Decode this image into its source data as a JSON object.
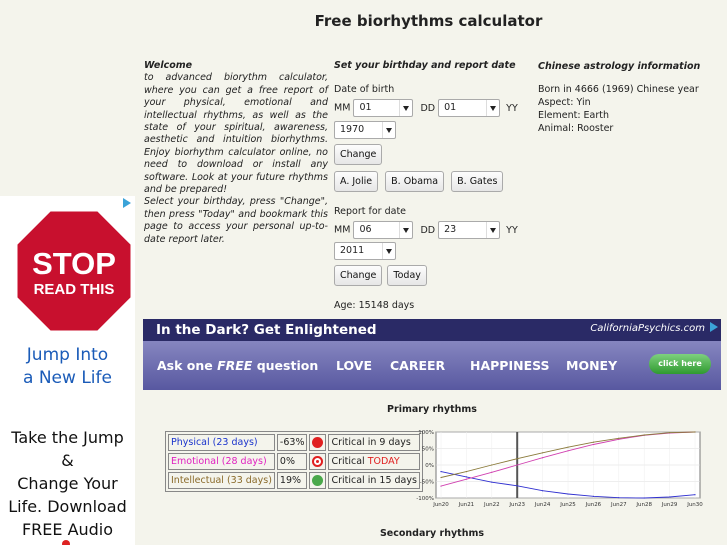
{
  "page": {
    "title": "Free biorhythms calculator"
  },
  "welcome": {
    "heading": "Welcome",
    "p1": "to advanced biorythm calculator, where you can get a free report of your physical, emotional and intellectual rhythms, as well as the state of your spiritual, awareness, aesthetic and intuition biorhythms. Enjoy biorhythm calculator online, no need to download or install any software. Look at your future rhythms and be prepared!",
    "p2": "Select your birthday, press \"Change\", then press \"Today\" and bookmark this page to access your personal up-to-date report later."
  },
  "birth_form": {
    "heading": "Set your birthday and report date",
    "label": "Date of birth",
    "mm_label": "MM",
    "mm_value": "01",
    "dd_label": "DD",
    "dd_value": "01",
    "yy_label": "YY",
    "yy_value": "1970",
    "change_label": "Change",
    "presets": [
      "A. Jolie",
      "B. Obama",
      "B. Gates"
    ]
  },
  "report_form": {
    "label": "Report for date",
    "mm_label": "MM",
    "mm_value": "06",
    "dd_label": "DD",
    "dd_value": "23",
    "yy_label": "YY",
    "yy_value": "2011",
    "change_label": "Change",
    "today_label": "Today"
  },
  "age": "Age: 15148 days",
  "chinese": {
    "heading": "Chinese astrology information",
    "born": "Born in 4666 (1969) Chinese year",
    "aspect": "Aspect: Yin",
    "element": "Element: Earth",
    "animal": "Animal: Rooster"
  },
  "ad_left": {
    "stop_line1": "STOP",
    "stop_line2": "READ THIS",
    "jump1": "Jump Into",
    "jump2": "a New Life",
    "take1": "Take the Jump",
    "take2": "&",
    "take3": "Change Your",
    "take4": "Life.  Download",
    "take5": "FREE Audio"
  },
  "banner": {
    "headline": "In the Dark? Get Enlightened",
    "brand": "CaliforniaPsychics.com",
    "ask_prefix": "Ask one ",
    "ask_free": "FREE",
    "ask_suffix": " question",
    "cats": [
      "LOVE",
      "CAREER",
      "HAPPINESS",
      "MONEY"
    ],
    "click": "click here"
  },
  "primary": {
    "title": "Primary rhythms",
    "rows": [
      {
        "name": "Physical (23 days)",
        "value": "-63%",
        "status_prefix": "Critical in 9 days",
        "status_hl": "",
        "name_color": "#1a33cc",
        "dot": "#e02020"
      },
      {
        "name": "Emotional (28 days)",
        "value": "0%",
        "status_prefix": "Critical ",
        "status_hl": "TODAY",
        "name_color": "#e020c0",
        "dot": "#e02020"
      },
      {
        "name": "Intellectual (33 days)",
        "value": "19%",
        "status_prefix": "Critical in 15 days",
        "status_hl": "",
        "name_color": "#8a6a2a",
        "dot": "#4aa84a"
      }
    ]
  },
  "chart_data": {
    "type": "line",
    "x": [
      "Jun20",
      "Jun21",
      "Jun22",
      "Jun23",
      "Jun24",
      "Jun25",
      "Jun26",
      "Jun27",
      "Jun28",
      "Jun29",
      "Jun30"
    ],
    "ylim": [
      -100,
      100
    ],
    "yticks": [
      "100%",
      "50%",
      "0%",
      "-50%",
      "-100%"
    ],
    "today_index": 3,
    "series": [
      {
        "color": "#3030d0",
        "values": [
          -20,
          -36,
          -52,
          -63,
          -78,
          -88,
          -95,
          -99,
          -100,
          -97,
          -90
        ]
      },
      {
        "color": "#d040b0",
        "values": [
          -64,
          -43,
          -22,
          0,
          22,
          43,
          62,
          78,
          90,
          97,
          100
        ]
      },
      {
        "color": "#8a7a3a",
        "values": [
          -38,
          -20,
          0,
          19,
          37,
          54,
          69,
          81,
          91,
          98,
          100
        ]
      }
    ]
  },
  "secondary": {
    "title": "Secondary rhythms"
  }
}
